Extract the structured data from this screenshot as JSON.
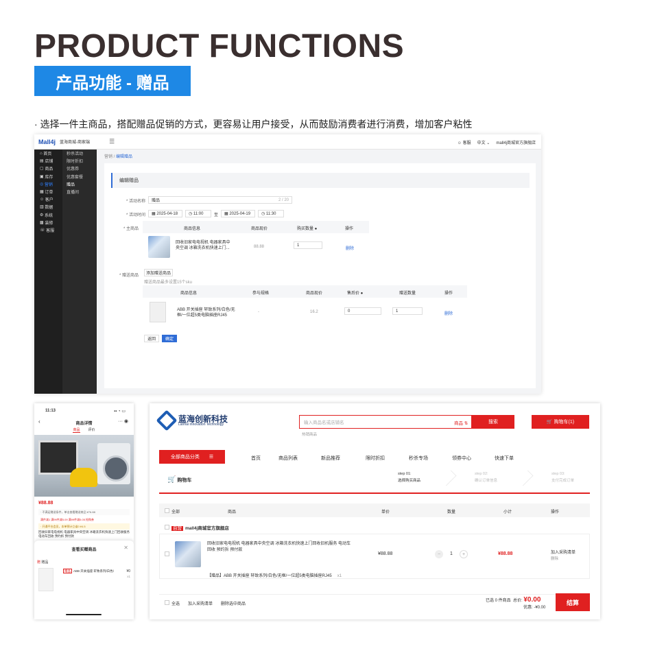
{
  "hero": {
    "title": "PRODUCT FUNCTIONS",
    "badge": "产品功能 - 赠品",
    "desc": "· 选择一件主商品，搭配赠品促销的方式，更容易让用户接受，从而鼓励消费者进行消费，增加客户粘性"
  },
  "admin": {
    "logo": "Mall4j",
    "store": "蓝海商城-商家端",
    "right": [
      "客服",
      "中文",
      "mall4j商城官方旗舰店"
    ],
    "side1": [
      "首页",
      "店铺",
      "商品",
      "库存",
      "营销",
      "订单",
      "客户",
      "数据",
      "系统",
      "装修",
      "客服"
    ],
    "side1_active": 4,
    "side2": [
      "秒杀活动",
      "限时折扣",
      "优惠券",
      "优惠套餐",
      "赠品",
      "直播间"
    ],
    "side2_active": 4,
    "crumb1": "营销",
    "crumb2": "编辑赠品",
    "card_title": "编辑赠品",
    "name_label": "* 活动名称",
    "name_value": "赠品",
    "name_count": "2 / 20",
    "time_label": "* 活动时间",
    "date1": "2025-04-18",
    "time1": "11:00",
    "to": "至",
    "date2": "2025-04-19",
    "time2": "11:30",
    "main_label": "* 主商品",
    "main_cols": [
      "商品信息",
      "商品现价",
      "购买数量",
      "操作"
    ],
    "main_item": {
      "name": "回收旧家电电视机 电器家具中央空调 冰箱洗衣机快速上门...",
      "price": "88.88",
      "qty": "1",
      "op": "删除"
    },
    "gift_label": "* 赠送商品",
    "add_gift": "添加赠送商品",
    "gift_hint": "赠送商品最多设置15个sku",
    "gift_cols": [
      "商品信息",
      "参与规格",
      "商品现价",
      "售后价",
      "赠送数量",
      "操作"
    ],
    "gift_item": {
      "name": "ABB 开关插座 轩致系列/白色/无框/一位超5类电脑插座RJ45",
      "spec": "-",
      "price": "16.2",
      "after": "0",
      "qty": "1",
      "op": "删除"
    },
    "btn_back": "返回",
    "btn_ok": "确定"
  },
  "phone": {
    "time": "11:13",
    "title": "商品详情",
    "tabs": [
      "商品",
      "评价"
    ],
    "price": "¥88.88",
    "row1": "· 不满足赠送条件，单击查看赠送商品 ¥76.88",
    "row2": "满件减1  满99件减5.09  满99件减5.05  抢购券",
    "row3": "· 开通平台会员，本单预计立省0 ¥4.5",
    "desc": "回收旧家电电视机 电器家具中央空调 冰箱洗衣机快速上门回收服务电动车回收 预约拆 预付款",
    "sheet_title": "查看买赠商品",
    "gift_label_tag": "赠",
    "gift_label": "赠品",
    "item_tag": "赠品",
    "item_name": "ABB 开关插座 轩致系列/白色/",
    "item_price": "¥0",
    "item_qty": "x1"
  },
  "web": {
    "brand": "蓝海创新科技",
    "brand_en": "Lanhai Innovation Technology",
    "search_placeholder": "输入商品名或店铺名",
    "search_scope": "商品",
    "search_btn": "搜索",
    "hot": "热销商品",
    "cart_btn": "购物车(1)",
    "cat": "全部商品分类",
    "nav": [
      "首页",
      "商品列表",
      "新品推荐",
      "限时折扣",
      "秒杀专场",
      "领券中心",
      "快速下单"
    ],
    "cart_title": "购物车",
    "steps": [
      {
        "n": "step 01:",
        "t": "选择购买商品"
      },
      {
        "n": "step 02:",
        "t": "确认订单信息"
      },
      {
        "n": "step 03:",
        "t": "支付完成订单"
      }
    ],
    "cols": [
      "全部",
      "商品",
      "单价",
      "数量",
      "小计",
      "操作"
    ],
    "shop_tag": "自营",
    "shop": "mall4j商城官方旗舰店",
    "item": "回收旧家电电视机 电器家具中央空调 冰箱洗衣机快速上门回收旧机服务 电动车回收 预约拆 预付款",
    "price": "¥88.88",
    "qty": "1",
    "subtotal": "¥88.88",
    "add_list": "加入采购清单",
    "del": "删除",
    "gift": "【赠品】ABB 开关插座 轩致系列/白色/无框/一位超5类电脑插座RJ45",
    "gift_qty": "x1",
    "sel_all": "全选",
    "foot_add": "加入采购清单",
    "foot_del": "删除选中商品",
    "selected": "已选 0 件商品",
    "total_label": "总价:",
    "total": "¥0.00",
    "discount": "优惠: -¥0.00",
    "settle": "结算"
  }
}
